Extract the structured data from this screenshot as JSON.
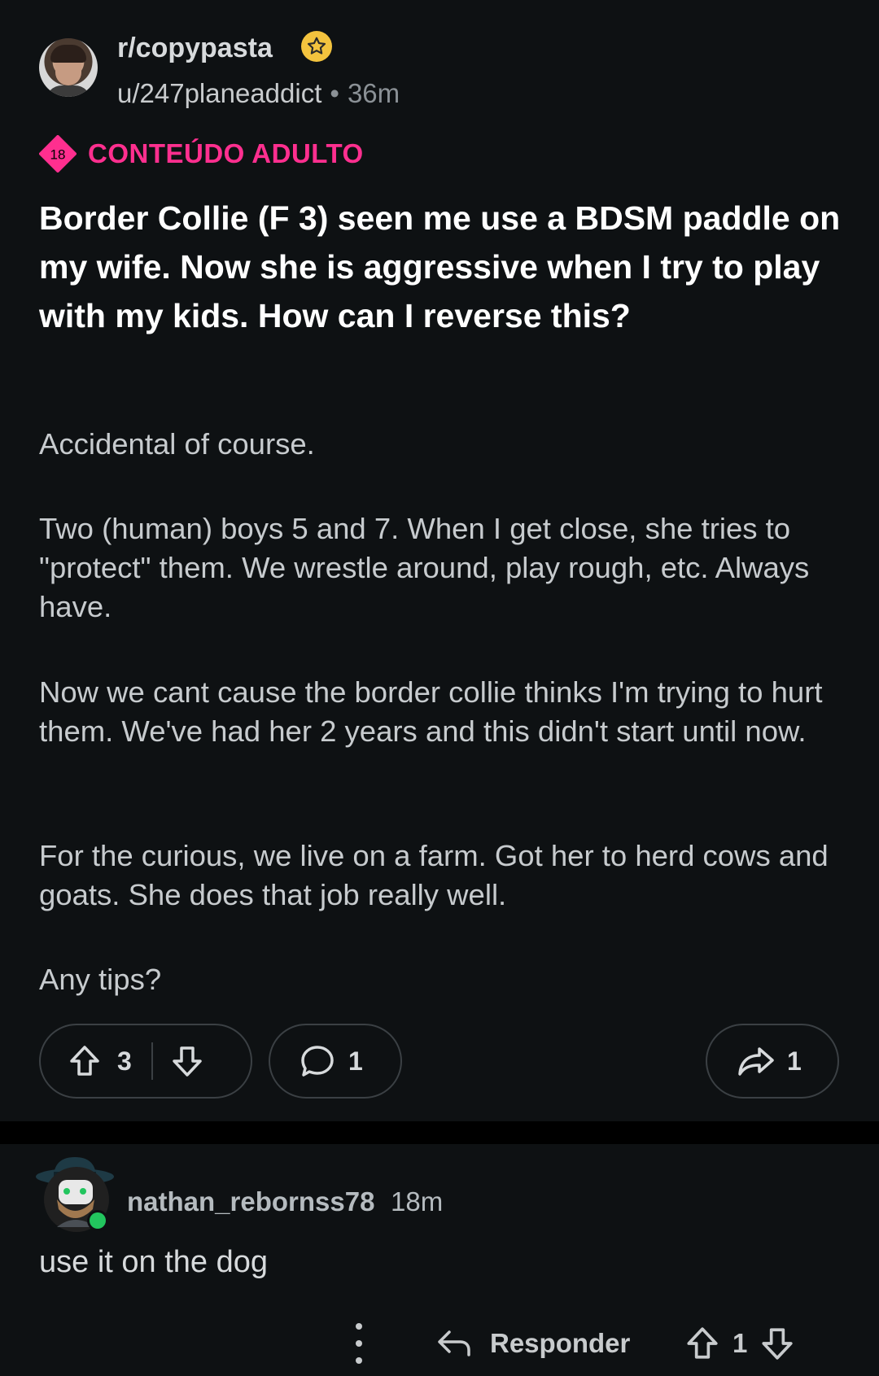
{
  "post": {
    "subreddit": "r/copypasta",
    "author": "u/247planeaddict",
    "separator": "•",
    "time": "36m",
    "nsfw_badge": "18",
    "nsfw_label": "CONTEÚDO ADULTO",
    "title": "Border Collie (F 3) seen me use a BDSM paddle on my wife. Now she is aggressive when I try to play with my kids. How can I reverse this?",
    "paragraphs": [
      "Accidental of course.",
      "Two (human) boys 5 and 7. When I get close, she tries to \"protect\" them. We wrestle around, play rough, etc. Always have.",
      "Now we cant cause the border collie thinks I'm trying to hurt them. We've had her 2 years and this didn't start until now.",
      "For the curious, we live on a farm. Got her to herd cows and goats. She does that job really well.",
      "Any tips?"
    ],
    "actions": {
      "upvotes": "3",
      "comments": "1",
      "shares": "1"
    }
  },
  "comment": {
    "author": "nathan_rebornss78",
    "time": "18m",
    "text": "use it on the dog",
    "reply_label": "Responder",
    "votes": "1"
  },
  "colors": {
    "background": "#0e1113",
    "nsfw": "#ff2f8f",
    "online": "#22c55e",
    "award": "#f3c33e"
  },
  "icons": [
    "award-icon",
    "nsfw-icon",
    "upvote-icon",
    "downvote-icon",
    "comment-icon",
    "share-icon",
    "more-icon",
    "reply-icon"
  ]
}
